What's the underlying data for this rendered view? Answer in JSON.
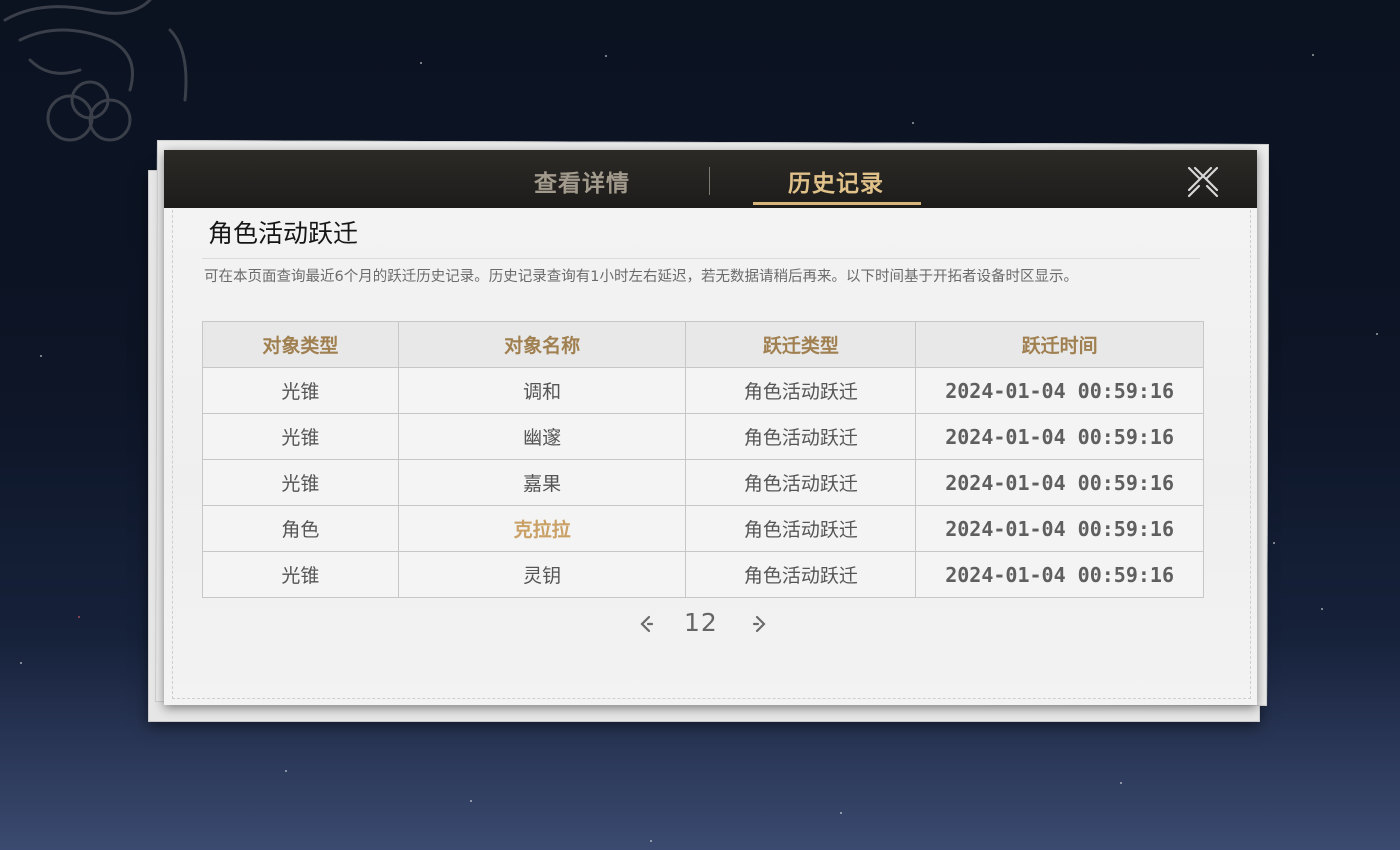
{
  "tabs": {
    "details": "查看详情",
    "history": "历史记录",
    "active": "history"
  },
  "title": "角色活动跃迁",
  "notice": "可在本页面查询最近6个月的跃迁历史记录。历史记录查询有1小时左右延迟，若无数据请稍后再来。以下时间基于开拓者设备时区显示。",
  "table": {
    "headers": [
      "对象类型",
      "对象名称",
      "跃迁类型",
      "跃迁时间"
    ],
    "rows": [
      {
        "type": "光锥",
        "name": "调和",
        "warp": "角色活动跃迁",
        "time": "2024-01-04 00:59:16",
        "highlight": false
      },
      {
        "type": "光锥",
        "name": "幽邃",
        "warp": "角色活动跃迁",
        "time": "2024-01-04 00:59:16",
        "highlight": false
      },
      {
        "type": "光锥",
        "name": "嘉果",
        "warp": "角色活动跃迁",
        "time": "2024-01-04 00:59:16",
        "highlight": false
      },
      {
        "type": "角色",
        "name": "克拉拉",
        "warp": "角色活动跃迁",
        "time": "2024-01-04 00:59:16",
        "highlight": true
      },
      {
        "type": "光锥",
        "name": "灵钥",
        "warp": "角色活动跃迁",
        "time": "2024-01-04 00:59:16",
        "highlight": false
      }
    ]
  },
  "pagination": {
    "page": "12"
  },
  "icons": {
    "close": "close-icon",
    "prev": "chevron-left-icon",
    "next": "chevron-right-icon"
  },
  "colors": {
    "accent": "#d7b57b",
    "header_text": "#a08050",
    "highlight": "#c9a065",
    "tabbar": "#1d1c1a"
  }
}
